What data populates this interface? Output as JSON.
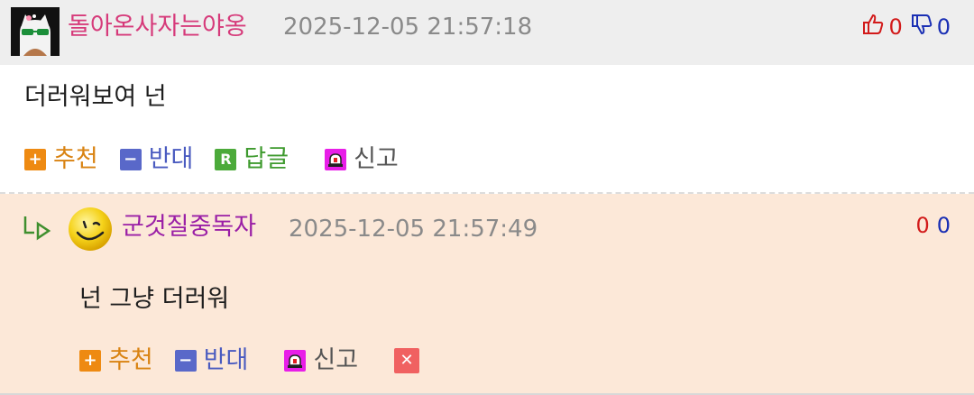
{
  "comment1": {
    "nickname": "돌아온사자는야옹",
    "timestamp": "2025-12-05 21:57:18",
    "upvotes": "0",
    "downvotes": "0",
    "text": "더러워보여 넌",
    "actions": {
      "recommend": "추천",
      "oppose": "반대",
      "reply": "답글",
      "report": "신고",
      "reply_badge": "R"
    }
  },
  "comment2": {
    "nickname": "군것질중독자",
    "timestamp": "2025-12-05 21:57:49",
    "upvotes": "0",
    "downvotes": "0",
    "text": "넌 그냥 더러워",
    "actions": {
      "recommend": "추천",
      "oppose": "반대",
      "report": "신고"
    }
  },
  "colors": {
    "header_bg": "#eeeeee",
    "reply_bg": "#fce8d8",
    "nick1": "#d63a7a",
    "nick2": "#9a1ea6",
    "upvote": "#d21a1a",
    "downvote": "#1a2fb4"
  }
}
